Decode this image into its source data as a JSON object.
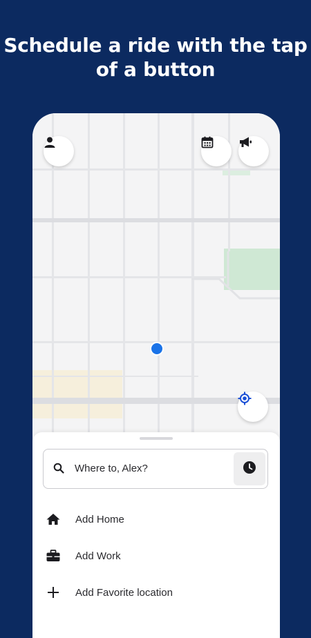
{
  "headline": {
    "line1": "Schedule a ride with the tap",
    "line2": "of a button"
  },
  "icons": {
    "profile": "person-icon",
    "schedule": "calendar-icon",
    "announcements": "megaphone-icon",
    "locate": "crosshair-icon",
    "search": "search-icon",
    "clock": "clock-icon"
  },
  "search": {
    "placeholder": "Where to, Alex?"
  },
  "shortcuts": [
    {
      "label": "Add Home",
      "icon": "home-icon"
    },
    {
      "label": "Add Work",
      "icon": "briefcase-icon"
    },
    {
      "label": "Add Favorite location",
      "icon": "plus-icon"
    }
  ],
  "colors": {
    "background": "#0c2a60",
    "location_dot": "#1a73e8",
    "park": "#cfe8d4",
    "map_base": "#f4f4f5",
    "road": "#dcdde1"
  }
}
